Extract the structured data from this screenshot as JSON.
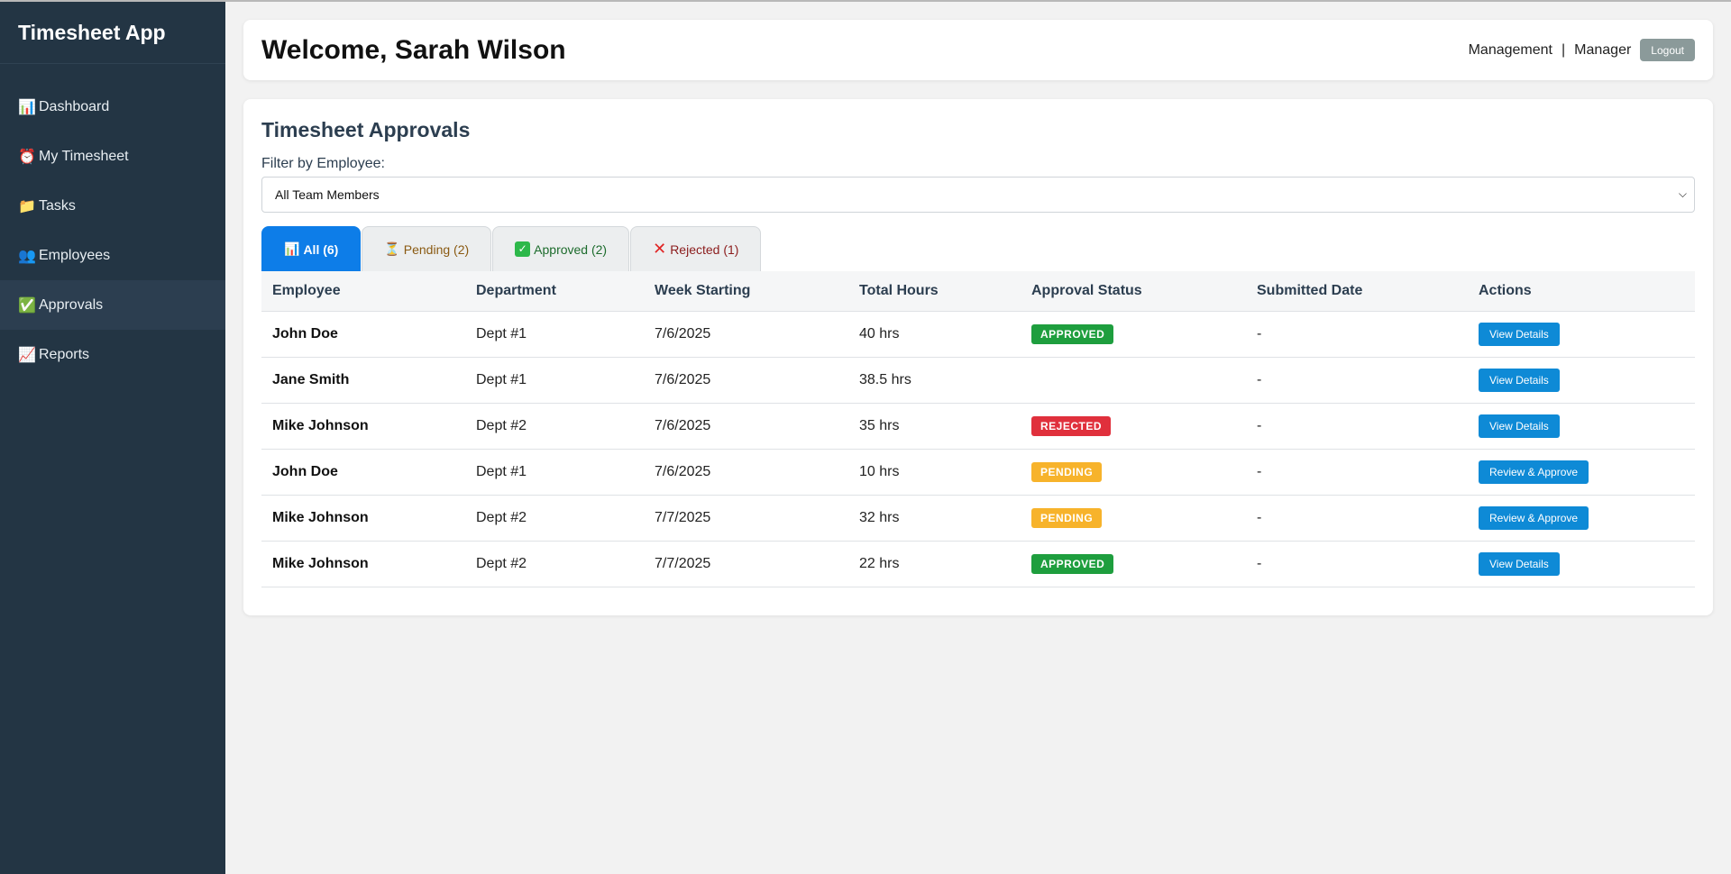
{
  "app": {
    "title": "Timesheet App"
  },
  "sidebar": {
    "items": [
      {
        "icon": "📊",
        "icon_name": "chart-icon",
        "label": "Dashboard",
        "active": false
      },
      {
        "icon": "⏰",
        "icon_name": "alarm-clock-icon",
        "label": "My Timesheet",
        "active": false
      },
      {
        "icon": "📁",
        "icon_name": "folder-icon",
        "label": "Tasks",
        "active": false
      },
      {
        "icon": "👥",
        "icon_name": "people-icon",
        "label": "Employees",
        "active": false
      },
      {
        "icon": "✅",
        "icon_name": "check-icon",
        "label": "Approvals",
        "active": true
      },
      {
        "icon": "📈",
        "icon_name": "trend-icon",
        "label": "Reports",
        "active": false
      }
    ]
  },
  "header": {
    "welcome": "Welcome, Sarah Wilson",
    "department": "Management",
    "separator": "|",
    "role": "Manager",
    "logout_label": "Logout"
  },
  "approvals": {
    "title": "Timesheet Approvals",
    "filter_label": "Filter by Employee:",
    "filter_value": "All Team Members",
    "tabs": [
      {
        "icon": "📊",
        "icon_name": "chart-icon",
        "label": "All (6)",
        "active": true
      },
      {
        "icon": "⏳",
        "icon_name": "hourglass-icon",
        "label": "Pending (2)",
        "active": false
      },
      {
        "icon": "✓",
        "icon_name": "check-icon",
        "label": "Approved (2)",
        "active": false
      },
      {
        "icon": "✕",
        "icon_name": "x-icon",
        "label": "Rejected (1)",
        "active": false
      }
    ],
    "columns": [
      "Employee",
      "Department",
      "Week Starting",
      "Total Hours",
      "Approval Status",
      "Submitted Date",
      "Actions"
    ],
    "rows": [
      {
        "employee": "John Doe",
        "department": "Dept #1",
        "week": "7/6/2025",
        "hours": "40 hrs",
        "status": "APPROVED",
        "status_type": "approved",
        "submitted": "-",
        "action": "View Details"
      },
      {
        "employee": "Jane Smith",
        "department": "Dept #1",
        "week": "7/6/2025",
        "hours": "38.5 hrs",
        "status": "",
        "status_type": "",
        "submitted": "-",
        "action": "View Details"
      },
      {
        "employee": "Mike Johnson",
        "department": "Dept #2",
        "week": "7/6/2025",
        "hours": "35 hrs",
        "status": "REJECTED",
        "status_type": "rejected",
        "submitted": "-",
        "action": "View Details"
      },
      {
        "employee": "John Doe",
        "department": "Dept #1",
        "week": "7/6/2025",
        "hours": "10 hrs",
        "status": "PENDING",
        "status_type": "pending",
        "submitted": "-",
        "action": "Review & Approve"
      },
      {
        "employee": "Mike Johnson",
        "department": "Dept #2",
        "week": "7/7/2025",
        "hours": "32 hrs",
        "status": "PENDING",
        "status_type": "pending",
        "submitted": "-",
        "action": "Review & Approve"
      },
      {
        "employee": "Mike Johnson",
        "department": "Dept #2",
        "week": "7/7/2025",
        "hours": "22 hrs",
        "status": "APPROVED",
        "status_type": "approved",
        "submitted": "-",
        "action": "View Details"
      }
    ]
  },
  "colors": {
    "sidebar_bg": "#233544",
    "tab_active": "#0d7de8",
    "approved": "#1e9e3e",
    "rejected": "#e0303c",
    "pending": "#f7b32b",
    "action_button": "#0e8ad6"
  }
}
